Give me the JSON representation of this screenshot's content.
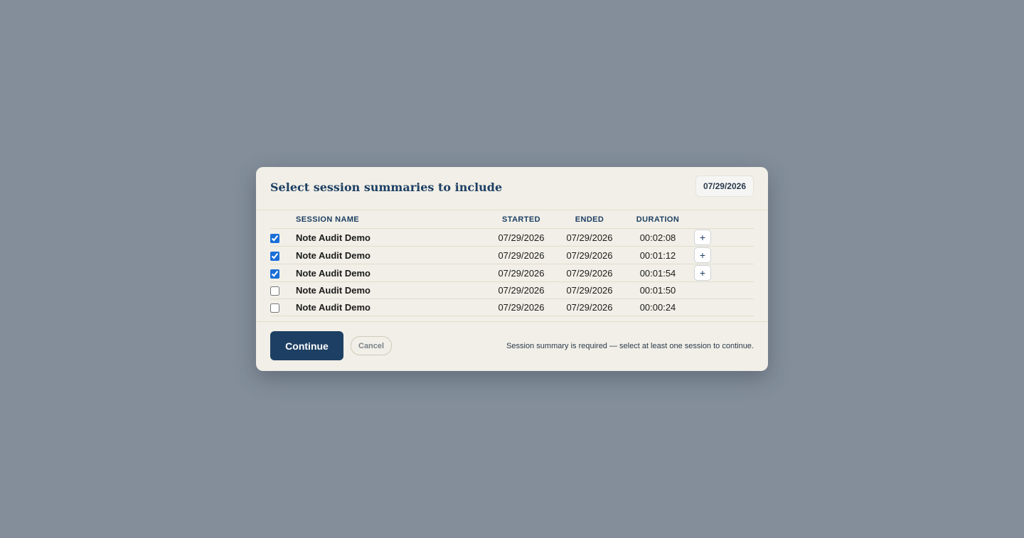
{
  "dialog": {
    "title": "Select session summaries to include",
    "date": "07/29/2026"
  },
  "table": {
    "columns": {
      "name": "SESSION NAME",
      "started": "STARTED",
      "ended": "ENDED",
      "duration": "DURATION"
    },
    "rows": [
      {
        "checked": true,
        "name": "Note Audit Demo",
        "started": "07/29/2026",
        "ended": "07/29/2026",
        "duration": "00:02:08",
        "action": "+"
      },
      {
        "checked": true,
        "name": "Note Audit Demo",
        "started": "07/29/2026",
        "ended": "07/29/2026",
        "duration": "00:01:12",
        "action": "+"
      },
      {
        "checked": true,
        "name": "Note Audit Demo",
        "started": "07/29/2026",
        "ended": "07/29/2026",
        "duration": "00:01:54",
        "action": "+"
      },
      {
        "checked": false,
        "name": "Note Audit Demo",
        "started": "07/29/2026",
        "ended": "07/29/2026",
        "duration": "00:01:50"
      },
      {
        "checked": false,
        "name": "Note Audit Demo",
        "started": "07/29/2026",
        "ended": "07/29/2026",
        "duration": "00:00:24"
      }
    ]
  },
  "footer": {
    "continue_label": "Continue",
    "cancel_label": "Cancel",
    "note": "Session summary is required — select at least one session to continue."
  },
  "colors": {
    "backdrop": "#838e9a",
    "dialog_bg": "#f1efe7",
    "accent": "#1d3f63",
    "checkbox": "#1a6fd8"
  }
}
